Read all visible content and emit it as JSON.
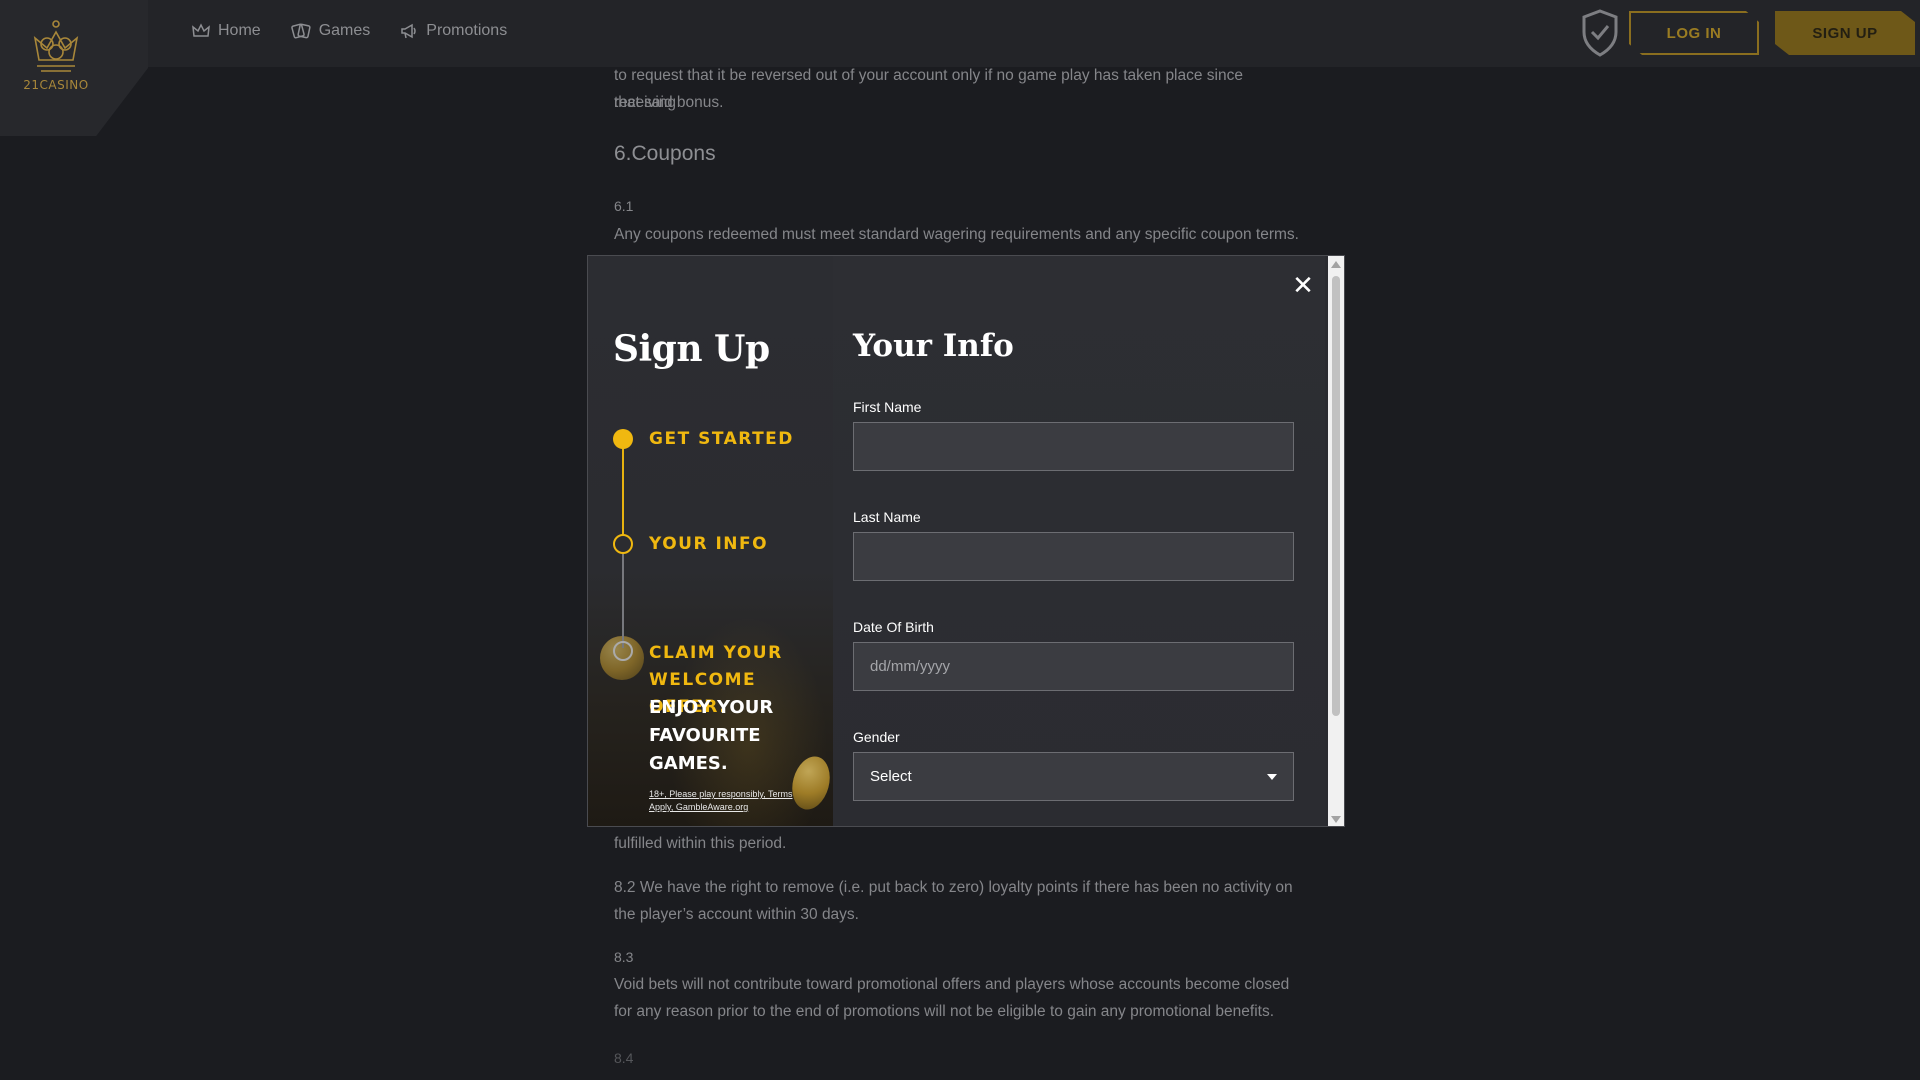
{
  "header": {
    "logo_text": "21CASINO",
    "nav": [
      {
        "label": "Home",
        "icon": "crown-icon"
      },
      {
        "label": "Games",
        "icon": "cards-icon"
      },
      {
        "label": "Promotions",
        "icon": "megaphone-icon"
      }
    ],
    "login_label": "LOG IN",
    "signup_label": "SIGN UP"
  },
  "article": {
    "line_a": "to request that it be reversed out of your account only if no game play has taken place since receiving",
    "line_b": "that said bonus.",
    "heading": "6.Coupons",
    "num_61": "6.1",
    "text_61": "Any coupons redeemed must meet standard wagering requirements and any specific coupon terms.",
    "line_c": "fulfilled within this period.",
    "text_82a": "8.2 We have the right to remove (i.e. put back to zero) loyalty points if there has been no activity on",
    "text_82b": "the player’s account within 30 days.",
    "num_83": "8.3",
    "text_83a": "Void bets will not contribute toward promotional offers and players whose accounts become closed",
    "text_83b": "for any reason prior to the end of promotions will not be eligible to gain any promotional benefits.",
    "num_84": "8.4"
  },
  "modal": {
    "close_symbol": "✕",
    "signup_title": "Sign Up",
    "steps": [
      {
        "label": "GET STARTED",
        "state": "completed"
      },
      {
        "label": "YOUR INFO",
        "state": "current"
      },
      {
        "label": "CLAIM YOUR WELCOME OFFER.",
        "state": "upcoming"
      }
    ],
    "enjoy_text": "ENJOY YOUR FAVOURITE GAMES.",
    "disclaimer": "18+, Please play responsibly, Terms Apply, GambleAware.org",
    "form_title": "Your Info",
    "fields": {
      "first_name_label": "First Name",
      "first_name_value": "",
      "last_name_label": "Last Name",
      "last_name_value": "",
      "dob_label": "Date Of Birth",
      "dob_placeholder": "dd/mm/yyyy",
      "gender_label": "Gender",
      "gender_selected": "Select"
    }
  },
  "colors": {
    "accent_gold": "#f0b810",
    "background": "#1b1c20",
    "modal_bg": "#2a2b30",
    "input_bg": "#3b3c41"
  }
}
